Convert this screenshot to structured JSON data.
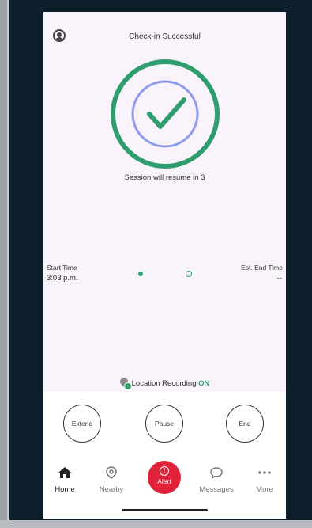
{
  "header": {
    "title": "Check-in Successful"
  },
  "status": {
    "resume_text": "Session will resume in 3"
  },
  "times": {
    "start_label": "Start Time",
    "start_value": "3:03 p.m.",
    "end_label": "Est. End Time",
    "end_value": "--"
  },
  "location": {
    "label": "Location Recording",
    "state": "ON"
  },
  "actions": {
    "extend": "Extend",
    "pause": "Pause",
    "end": "End"
  },
  "nav": {
    "home": "Home",
    "nearby": "Nearby",
    "alert": "Alert",
    "messages": "Messages",
    "more": "More"
  },
  "colors": {
    "success_green": "#2e9e6e",
    "ring_blue": "#8f9af0",
    "alert_red": "#e0223a",
    "screen_bg": "#f9f4fb"
  }
}
